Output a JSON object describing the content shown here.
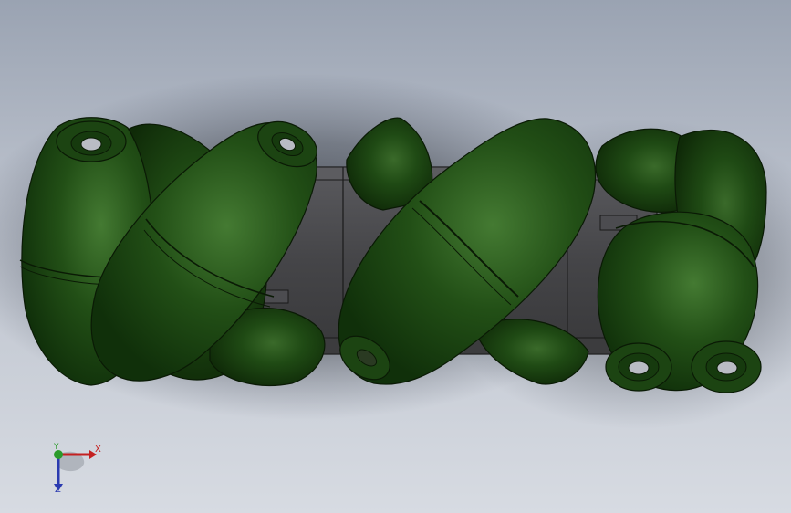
{
  "viewport": {
    "name": "3D model view",
    "background_top": "#9aa3b2",
    "background_bottom": "#d7dbe2"
  },
  "model": {
    "type": "mecanum wheel",
    "roller_color": "#1e4a12",
    "hub_color": "#4a4a4c",
    "roller_count_visible": 8
  },
  "triad": {
    "x_label": "X",
    "y_label": "Y",
    "z_label": "Z",
    "x_color": "#c42020",
    "y_color": "#2a9a2a",
    "z_color": "#2a3ab0"
  }
}
